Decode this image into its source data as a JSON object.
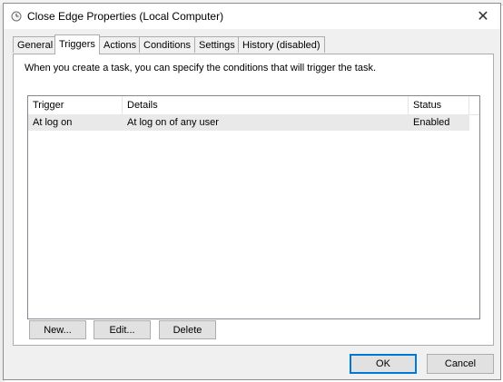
{
  "window": {
    "title": "Close Edge Properties (Local Computer)",
    "close_glyph": "✕"
  },
  "tabs": [
    {
      "label": "General"
    },
    {
      "label": "Triggers",
      "active": true
    },
    {
      "label": "Actions"
    },
    {
      "label": "Conditions"
    },
    {
      "label": "Settings"
    },
    {
      "label": "History (disabled)"
    }
  ],
  "triggers": {
    "description": "When you create a task, you can specify the conditions that will trigger the task.",
    "columns": {
      "trigger": "Trigger",
      "details": "Details",
      "status": "Status"
    },
    "rows": [
      {
        "trigger": "At log on",
        "details": "At log on of any user",
        "status": "Enabled"
      }
    ],
    "buttons": {
      "new": "New...",
      "edit": "Edit...",
      "delete": "Delete"
    }
  },
  "footer": {
    "ok": "OK",
    "cancel": "Cancel"
  },
  "colors": {
    "accent": "#0078d7",
    "selected_row": "#e9e9e9",
    "dialog_bg": "#f0f0f0"
  },
  "icons": {
    "title": "clock-icon",
    "close": "close-icon"
  }
}
